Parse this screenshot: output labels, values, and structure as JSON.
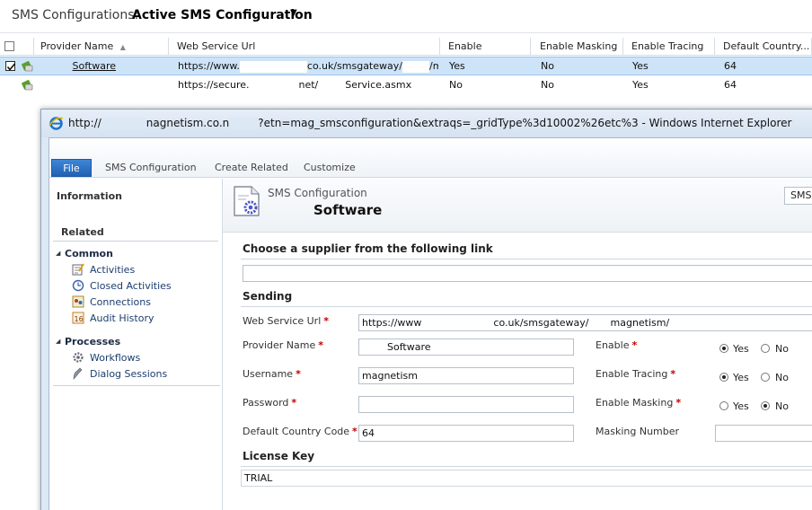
{
  "view": {
    "label": "SMS Configurations:",
    "name": "Active SMS Configuration",
    "dropdown_glyph": "▼"
  },
  "grid": {
    "columns": [
      "Provider Name",
      "Web Service Url",
      "Enable",
      "Enable Masking",
      "Enable Tracing",
      "Default Country..."
    ],
    "sort_glyph": "▲",
    "rows": [
      {
        "provider": "Software",
        "url_a": "https://www.",
        "url_b": "co.uk/smsgateway/",
        "url_c": "/m...",
        "enable": "Yes",
        "masking": "No",
        "tracing": "Yes",
        "country": "64"
      },
      {
        "provider": "",
        "url_a": "https://secure.",
        "url_b": "net/",
        "url_c": "Service.asmx",
        "enable": "No",
        "masking": "No",
        "tracing": "Yes",
        "country": "64"
      }
    ]
  },
  "window": {
    "title_a": "http://",
    "title_b": "nagnetism.co.n",
    "title_c": "?etn=mag_smsconfiguration&extraqs=_gridType%3d10002%26etc%3 - Windows Internet Explorer"
  },
  "ribbon": {
    "tabs": [
      "File",
      "SMS Configuration",
      "Create Related",
      "Customize"
    ]
  },
  "nav": {
    "information": "Information",
    "related": "Related",
    "common": "Common",
    "common_items": [
      "Activities",
      "Closed Activities",
      "Connections",
      "Audit History"
    ],
    "processes": "Processes",
    "process_items": [
      "Workflows",
      "Dialog Sessions"
    ]
  },
  "form": {
    "entity_type": "SMS Configuration",
    "record_name": "Software",
    "button_label": "SMS",
    "supplier_section": "Choose a supplier from the following link",
    "sending_section": "Sending",
    "license_section": "License Key",
    "fields": {
      "web_service_url": {
        "label": "Web Service Url",
        "value_a": "https://www",
        "value_b": "co.uk/smsgateway/",
        "value_c": "magnetism/"
      },
      "provider_name": {
        "label": "Provider Name",
        "value": "Software"
      },
      "username": {
        "label": "Username",
        "value": "magnetism"
      },
      "password": {
        "label": "Password",
        "value": ""
      },
      "default_country_code": {
        "label": "Default Country Code",
        "value": "64"
      },
      "enable": {
        "label": "Enable",
        "selected": "Yes"
      },
      "enable_tracing": {
        "label": "Enable Tracing",
        "selected": "Yes"
      },
      "enable_masking": {
        "label": "Enable Masking",
        "selected": "No"
      },
      "masking_number": {
        "label": "Masking Number",
        "value": ""
      },
      "license_key": {
        "value": "TRIAL"
      }
    },
    "yes": "Yes",
    "no": "No",
    "required_mark": "*"
  }
}
